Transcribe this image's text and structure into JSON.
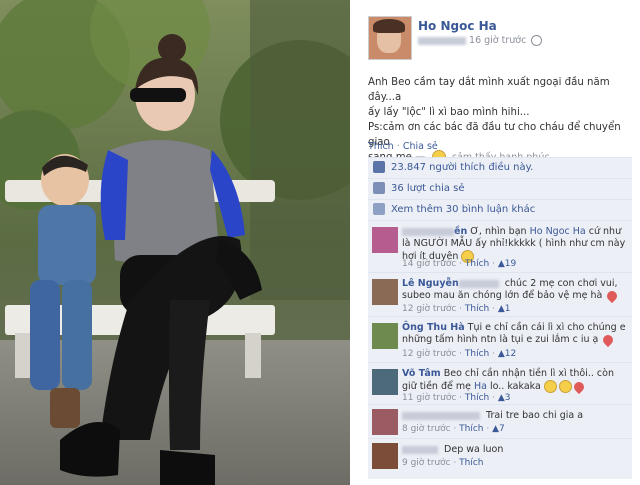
{
  "post": {
    "author": "Ho Ngoc Ha",
    "time": "16 giờ trước",
    "text_line1": "Anh Beo cầm tay dắt mình xuất ngoại đầu năm đây...a",
    "text_line2": "ấy lấy \"lộc\" lì xì bao mình hihi...",
    "text_line3": "Ps:cảm ơn các bác đã đầu tư cho cháu để chuyển giao",
    "text_line4a": "sang mẹ —",
    "feeling": "cảm thấy hạnh phúc.",
    "actions": {
      "like": "Thích",
      "sep": "·",
      "share": "Chia sẻ"
    },
    "likes": "23.847 người thích điều này.",
    "shares": "36 lượt chia sẻ",
    "more_comments": "Xem thêm 30 bình luận khác"
  },
  "comments": [
    {
      "name_visible": "ền",
      "text_a": "Ơ, nhìn bạn",
      "mention": "Ho Ngoc Ha",
      "text_b": "cứ như là NGƯỜI MẪU ấy nhỉ!kkkkk ( hình như cm này hơi ít duyên",
      "time": "14 giờ trước",
      "like": "Thích",
      "likes": "19"
    },
    {
      "name_visible": "Lê Nguyễn",
      "text_a": "chúc 2 mẹ con chơi vui, subeo mau ăn chóng lớn để bảo vệ mẹ hà",
      "time": "12 giờ trước",
      "like": "Thích",
      "likes": "1"
    },
    {
      "name_visible": "Ông Thu Hà",
      "text_a": "Tụi e chỉ cần cái lì xì cho chúng e những tấm hình ntn là tụi e zui lắm c iu ạ",
      "time": "12 giờ trước",
      "like": "Thích",
      "likes": "12"
    },
    {
      "name_visible": "Võ Tâm",
      "text_a": "Beo chỉ cần nhận tiền lì xì thôi.. còn giữ tiền để mẹ",
      "mention": "Ha",
      "text_b": "lo.. kakaka",
      "time": "11 giờ trước",
      "like": "Thích",
      "likes": "3"
    },
    {
      "text_a": "Trai tre bao chi gia a",
      "time": "8 giờ trước",
      "like": "Thích",
      "likes": "7"
    },
    {
      "text_a": "Dep wa luon",
      "time": "9 giờ trước",
      "like": "Thích"
    }
  ],
  "colors": {
    "link": "#3b5998",
    "row_bg": "#eceff5",
    "jacket": "#2a45c8"
  }
}
